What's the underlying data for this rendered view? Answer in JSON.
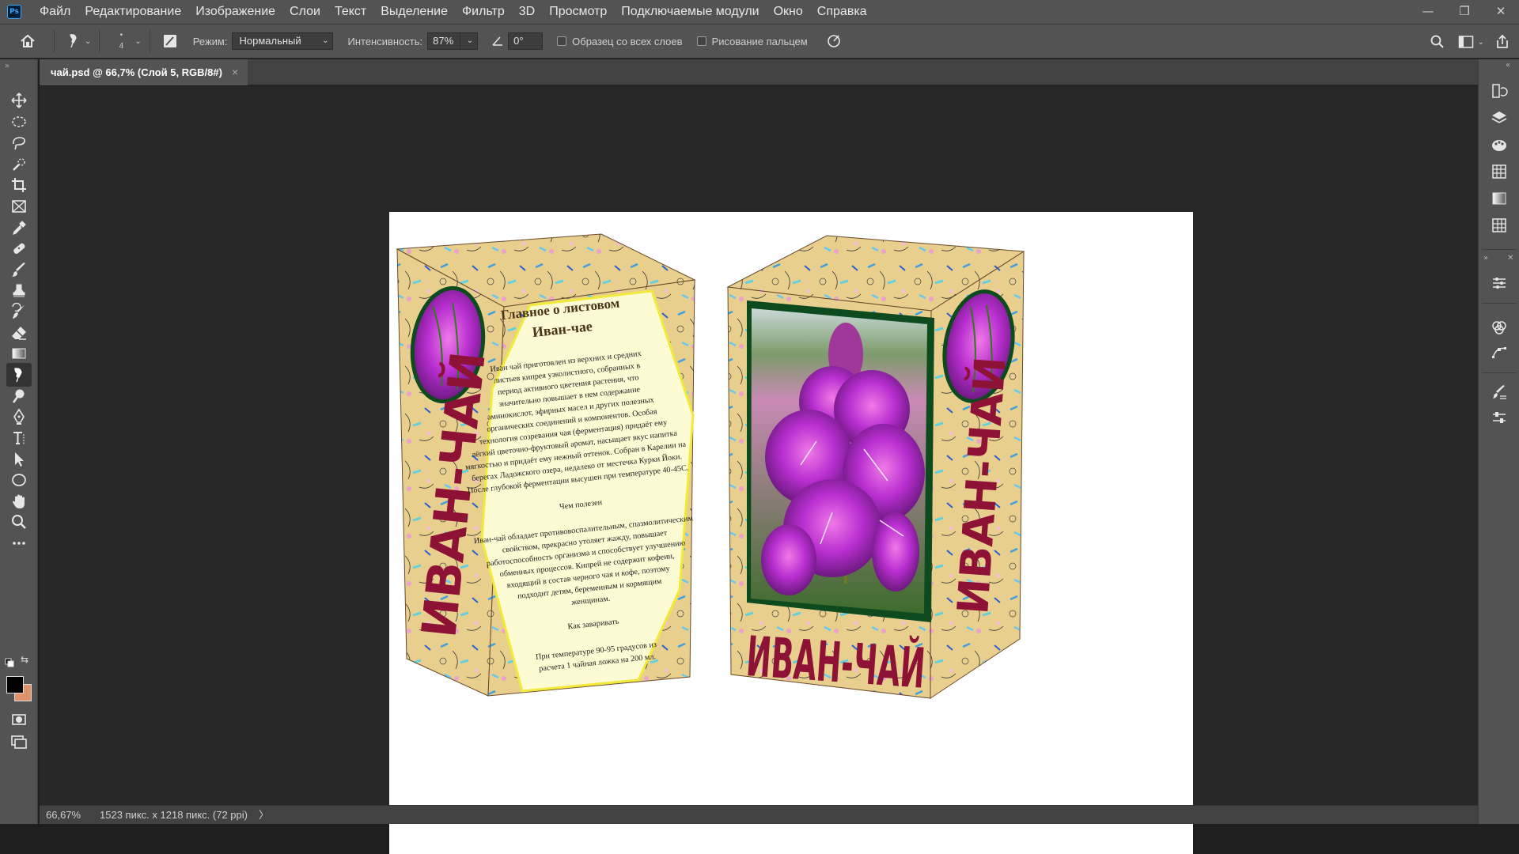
{
  "app": {
    "logo": "Ps"
  },
  "menu": [
    "Файл",
    "Редактирование",
    "Изображение",
    "Слои",
    "Текст",
    "Выделение",
    "Фильтр",
    "3D",
    "Просмотр",
    "Подключаемые модули",
    "Окно",
    "Справка"
  ],
  "window_controls": {
    "minimize": "—",
    "restore": "❐",
    "close": "✕"
  },
  "options": {
    "brush_size": "4",
    "mode_label": "Режим:",
    "mode_value": "Нормальный",
    "intensity_label": "Интенсивность:",
    "intensity_value": "87%",
    "angle_value": "0°",
    "sample_all_layers": "Образец со всех слоев",
    "finger_painting": "Рисование пальцем"
  },
  "document": {
    "tab_title": "чай.psd @ 66,7% (Слой 5, RGB/8#)",
    "tab_close": "×"
  },
  "status": {
    "zoom": "66,67%",
    "doc_info": "1523 пикс. x 1218 пикс. (72 ppi)",
    "arrow": "〉"
  },
  "artwork": {
    "left_box": {
      "heading_line1": "Главное о листовом",
      "heading_line2": "Иван-чае",
      "body": [
        "Иван чай приготовлен из верхних и средних",
        "листьев кипрея узколистного, собранных в",
        "период активного цветения растения, что",
        "значительно повышает в нем содержание",
        "аминокислот, эфирных масел и других полезных",
        "органических соединений и компонентов. Особая",
        "технология созревания чая (ферментация) придаёт ему",
        "лёгкий цветочно-фруктовый аромат, насыщает вкус напитка",
        "мягкостью и придаёт ему нежный оттенок. Собран в Карелии на",
        "берегах Ладожского озера, недалеко от местечка Курки Йоки.",
        "После глубокой ферментации высушен при температуре 40-45С."
      ],
      "benefits_heading": "Чем полезен",
      "benefits": [
        "Иван-чай обладает противовоспалительным, спазмолитическим",
        "свойством, прекрасно утоляет жажду, повышает",
        "работоспособность организма и способствует улучшению",
        "обменных процессов. Кипрей не содержит кофеин,",
        "входящий в состав черного чая и кофе, поэтому",
        "подходит детям, беременным и кормящим",
        "женщинам."
      ],
      "brew_heading": "Как заваривать",
      "brew": [
        "При температуре 90-95 градусов из",
        "расчета 1 чайная ложка на 200 мл."
      ],
      "side_brand": "ИВАН-ЧАЙ"
    },
    "right_box": {
      "front_brand": "ИВАН-ЧАЙ",
      "side_brand": "ИВАН-ЧАЙ"
    },
    "colors": {
      "box_base": "#e8cf8e",
      "panel_fill": "#fdfbd4",
      "brand_red": "#8d1235",
      "frame_green": "#0d4a1e",
      "flower": "#b82fd0"
    }
  }
}
